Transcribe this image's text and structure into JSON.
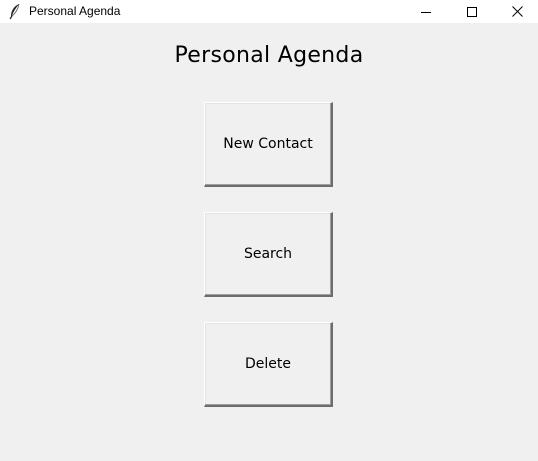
{
  "window": {
    "title": "Personal Agenda",
    "icon": "feather-icon",
    "controls": [
      "minimize-icon",
      "maximize-icon",
      "close-icon"
    ]
  },
  "main": {
    "heading": "Personal Agenda",
    "buttons": [
      {
        "label": "New Contact"
      },
      {
        "label": "Search"
      },
      {
        "label": "Delete"
      }
    ]
  },
  "colors": {
    "background": "#f0f0f0",
    "titlebar": "#ffffff",
    "text": "#000000"
  }
}
